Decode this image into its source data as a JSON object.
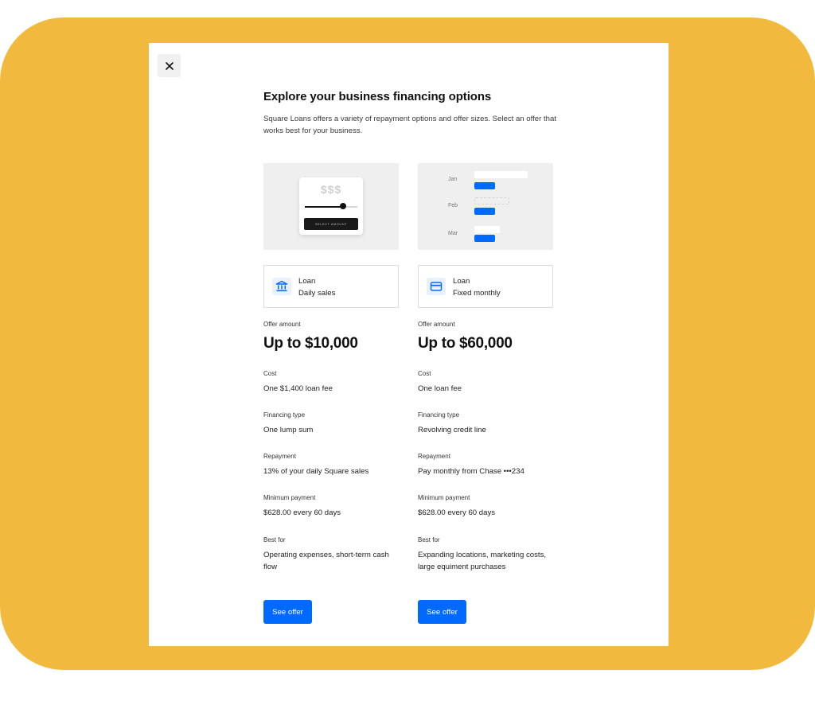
{
  "dialog": {
    "title": "Explore your business financing options",
    "subtitle": "Square Loans offers a variety of repayment options and offer sizes. Select an offer that works best for your business."
  },
  "illustration_a": {
    "currency": "$$$",
    "button_label": "SELECT AMOUNT",
    "slider_level": 0.73
  },
  "illustration_b": {
    "months": [
      "Jan",
      "Feb",
      "Mar"
    ]
  },
  "offers": [
    {
      "type_line1": "Loan",
      "type_line2": "Daily sales",
      "icon": "bank-icon",
      "offer_amount_label": "Offer amount",
      "offer_amount": "Up to $10,000",
      "cost_label": "Cost",
      "cost": "One $1,400 loan fee",
      "financing_type_label": "Financing type",
      "financing_type": "One lump sum",
      "repayment_label": "Repayment",
      "repayment": "13% of your daily Square sales",
      "minimum_payment_label": "Minimum payment",
      "minimum_payment": "$628.00 every 60 days",
      "best_for_label": "Best for",
      "best_for": "Operating expenses, short-term cash flow",
      "cta": "See offer"
    },
    {
      "type_line1": "Loan",
      "type_line2": "Fixed monthly",
      "icon": "credit-card-icon",
      "offer_amount_label": "Offer amount",
      "offer_amount": "Up to $60,000",
      "cost_label": "Cost",
      "cost": "One loan fee",
      "financing_type_label": "Financing type",
      "financing_type": "Revolving credit line",
      "repayment_label": "Repayment",
      "repayment": "Pay monthly from Chase •••234",
      "minimum_payment_label": "Minimum payment",
      "minimum_payment": "$628.00 every 60 days",
      "best_for_label": "Best for",
      "best_for": "Expanding locations, marketing costs, large equiment purchases",
      "cta": "See offer"
    }
  ],
  "colors": {
    "background": "#F1BA3E",
    "accent": "#006AFF",
    "icon_bg": "#E9F1FF"
  }
}
